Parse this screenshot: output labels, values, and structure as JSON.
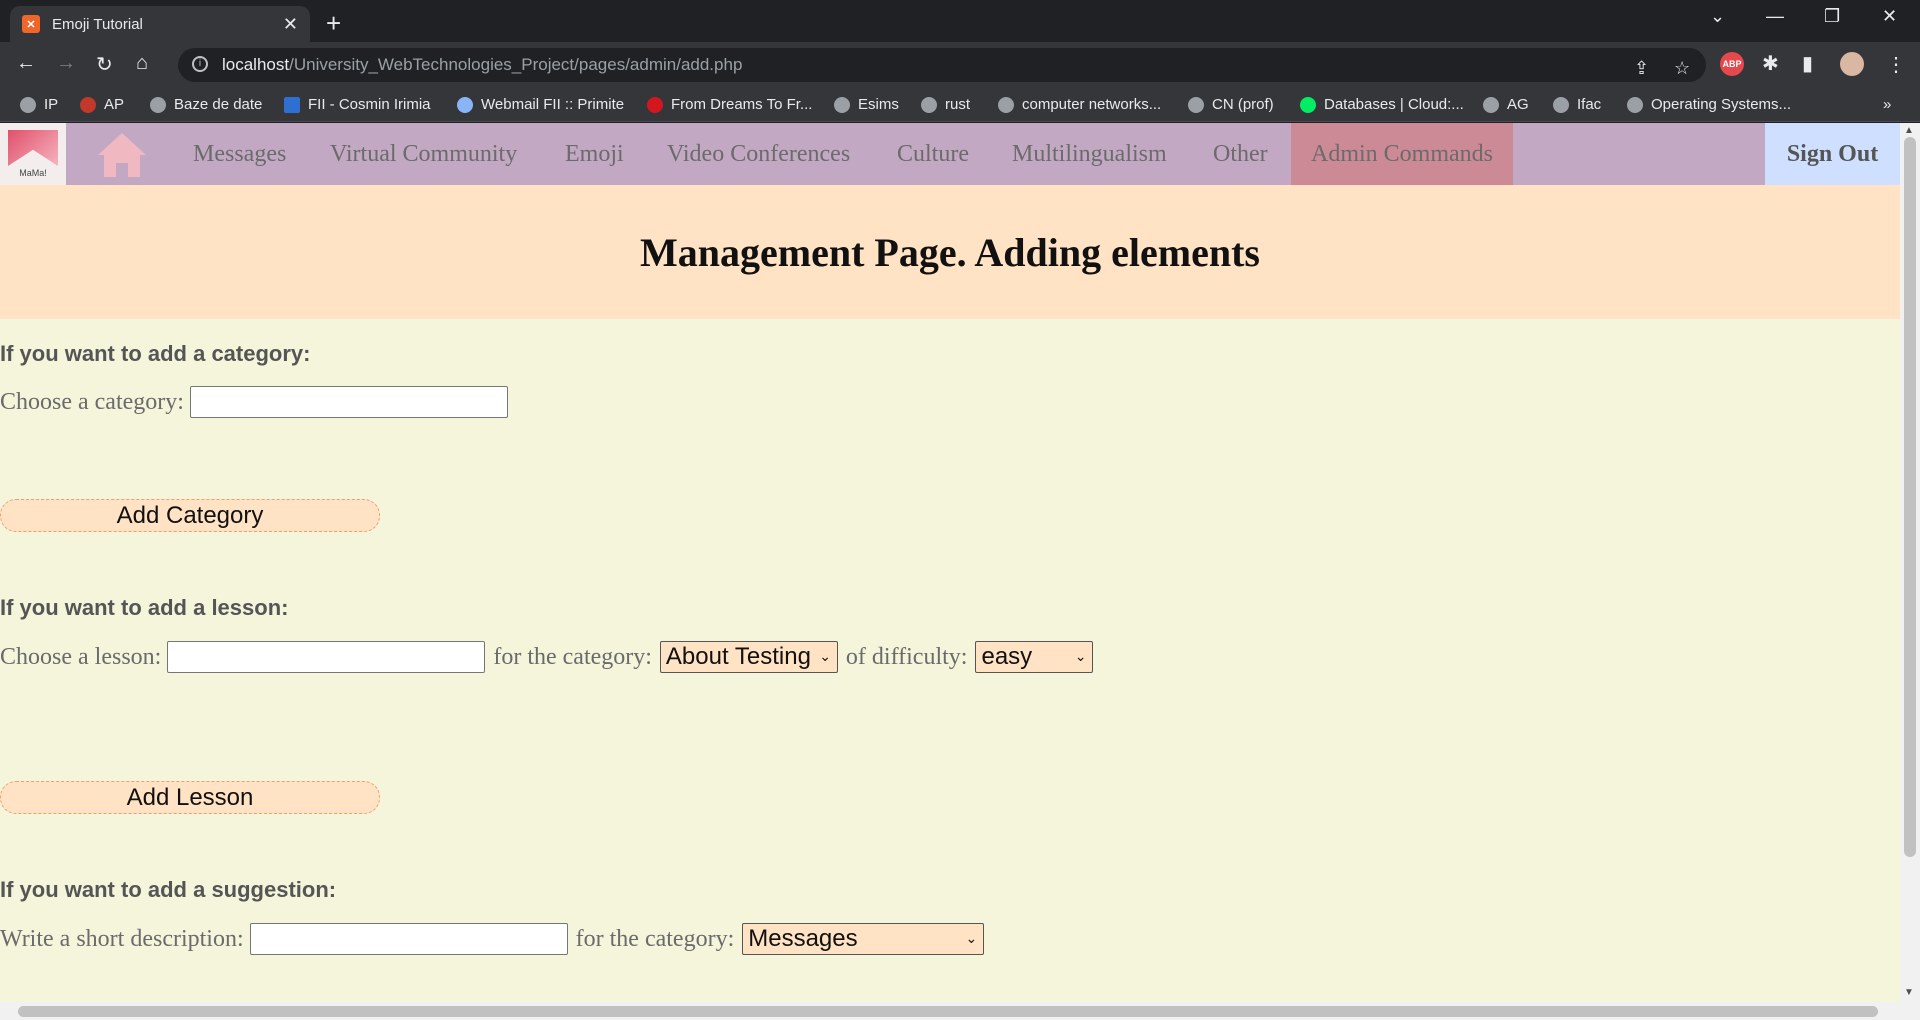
{
  "browser": {
    "tab_title": "Emoji Tutorial",
    "url_host": "localhost",
    "url_path": "/University_WebTechnologies_Project/pages/admin/add.php",
    "ext_abp": "ABP",
    "bookmarks": [
      "IP",
      "AP",
      "Baze de date",
      "FII - Cosmin Irimia",
      "Webmail FII :: Primite",
      "From Dreams To Fr...",
      "Esims",
      "rust",
      "computer networks...",
      "CN (prof)",
      "Databases | Cloud:...",
      "AG",
      "Ifac",
      "Operating Systems..."
    ]
  },
  "site": {
    "logo_text": "MaMa!",
    "nav": [
      "Messages",
      "Virtual Community",
      "Emoji",
      "Video Conferences",
      "Culture",
      "Multilingualism",
      "Other",
      "Admin Commands"
    ],
    "signout": "Sign Out",
    "title": "Management Page. Adding elements"
  },
  "category_form": {
    "heading": "If you want to add a category:",
    "label": "Choose a category:",
    "value": "",
    "button": "Add Category"
  },
  "lesson_form": {
    "heading": "If you want to add a lesson:",
    "label": "Choose a lesson:",
    "value": "",
    "category_label": "for the category:",
    "category_selected": "About Testing",
    "difficulty_label": "of difficulty:",
    "difficulty_selected": "easy",
    "button": "Add Lesson"
  },
  "suggestion_form": {
    "heading": "If you want to add a suggestion:",
    "label": "Write a short description:",
    "value": "",
    "category_label": "for the category:",
    "category_selected": "Messages"
  },
  "colors": {
    "nav_bg": "#c3a8c3",
    "active_nav": "#cc8a96",
    "banner_bg": "#ffe3c4",
    "page_bg": "#f5f5dc",
    "signout_bg": "#cfdfff"
  }
}
